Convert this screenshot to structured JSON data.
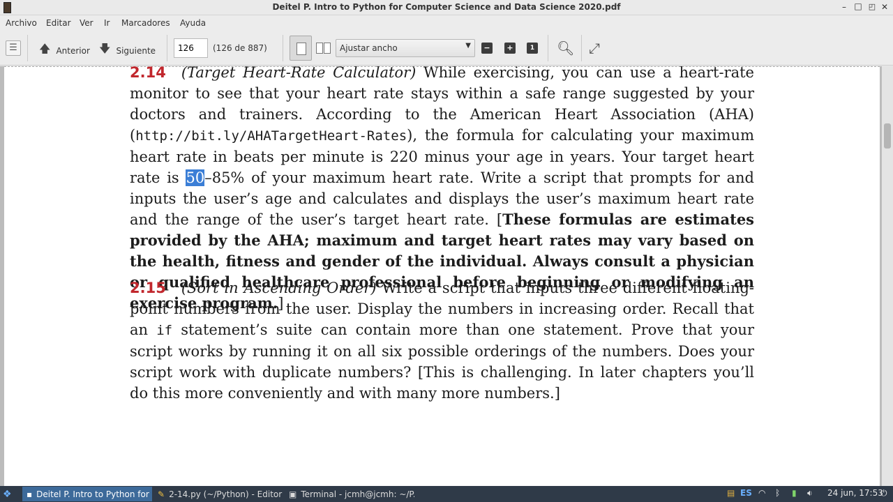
{
  "window": {
    "title": "Deitel P. Intro to Python for Computer Science and Data Science 2020.pdf",
    "controls": {
      "minimize": "–",
      "maximize": "□",
      "close": "✕"
    }
  },
  "menu": [
    "Archivo",
    "Editar",
    "Ver",
    "Ir",
    "Marcadores",
    "Ayuda"
  ],
  "toolbar": {
    "back_label": "Anterior",
    "forward_label": "Siguiente",
    "page_value": "126",
    "page_count": "(126 de 887)",
    "zoom_value": "Ajustar ancho"
  },
  "document": {
    "ex1": {
      "num": "2.14",
      "title": "(Target Heart-Rate Calculator)",
      "t1": " While exercising, you can use a heart-rate monitor to see that your heart rate stays within a safe range suggested by your doctors and trainers. According to the American Heart Association (AHA) (",
      "code": "http://bit.ly/AHATargetHeart-Rates",
      "t2": "), the formula for calculating your maximum heart rate in beats per minute is 220 minus your age in years. Your target heart rate is ",
      "highlight": "50",
      "t3": "–85% of your maximum heart rate. Write a script that prompts for and inputs the user’s age and calculates and displays the user’s maximum heart rate and the range of the user’s target heart rate. [",
      "bold": "These formulas are estimates provided by the AHA; maximum and target heart rates may vary based on the health, fitness and gender of the individual. Always consult a physician or qualified healthcare professional before beginning or modifying an exercise program.",
      "t4": "]"
    },
    "ex2": {
      "num": "2.15",
      "title": "(Sort in Ascending Order)",
      "t1": " Write a script that inputs three different floating-point numbers from the user. Display the numbers in increasing order. Recall that an ",
      "code": "if",
      "t2": " statement’s suite can contain more than one statement. Prove that your script works by running it on all six possible orderings of the numbers. Does your script work with duplicate numbers? [This is challenging. In later chapters you’ll do this more conveniently and with many more numbers.]"
    }
  },
  "taskbar": {
    "tasks": [
      {
        "label": "Deitel P. Intro to Python for ..."
      },
      {
        "label": "2-14.py (~/Python) - Editor d..."
      },
      {
        "label": "Terminal - jcmh@jcmh: ~/P..."
      }
    ],
    "keyboard_layout": "ES",
    "clock": "24 jun, 17:53"
  },
  "colors": {
    "accent": "#c1272d",
    "selection": "#3b7ed6",
    "taskbar": "#2f3a48"
  }
}
